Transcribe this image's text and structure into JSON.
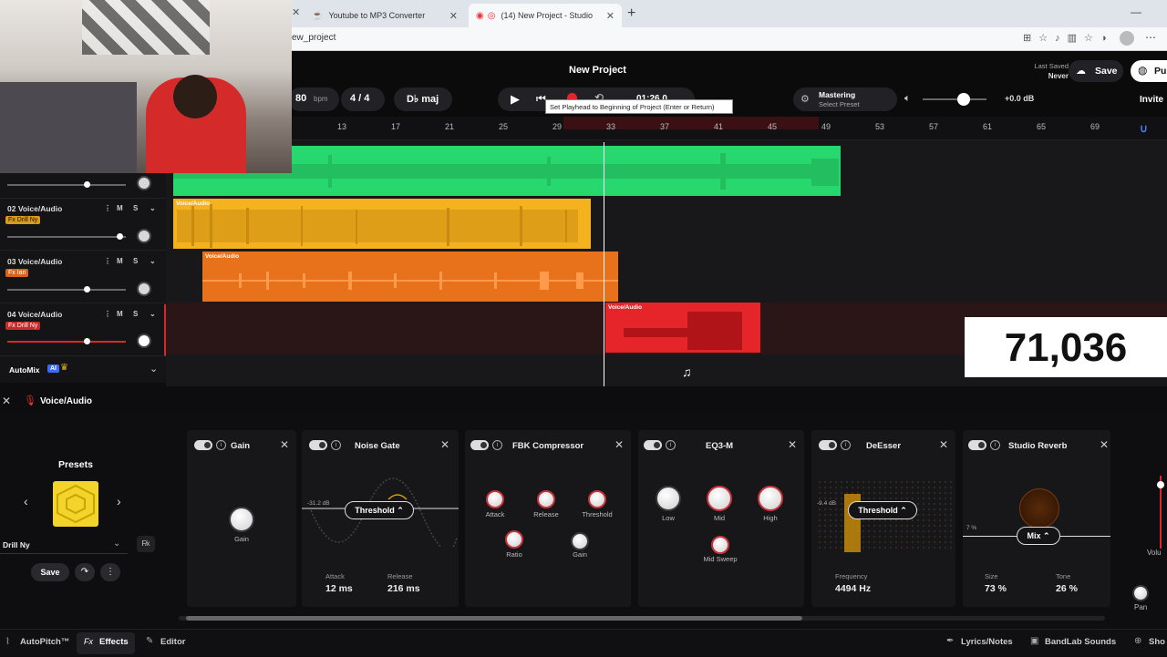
{
  "browser": {
    "tabs": [
      {
        "label": "Youtube to MP3 Converter"
      },
      {
        "label": "(14) New Project - Studio"
      }
    ],
    "url": "ew_project"
  },
  "project": {
    "title": "New Project",
    "last_saved_label": "Last Saved",
    "last_saved_value": "Never",
    "save_label": "Save",
    "publish_label": "Pu",
    "invite_label": "Invite"
  },
  "transport": {
    "bpm": "80",
    "bpm_unit": "bpm",
    "time_signature": "4 / 4",
    "key": "D♭ maj",
    "time_display": "01:26.0",
    "tooltip": "Set Playhead to Beginning of Project (Enter or Return)",
    "mastering_label": "Mastering",
    "mastering_preset": "Select Preset",
    "master_volume_db": "+0.0 dB"
  },
  "ruler": {
    "ticks": [
      "13",
      "17",
      "21",
      "25",
      "29",
      "33",
      "37",
      "41",
      "45",
      "49",
      "53",
      "57",
      "61",
      "65",
      "69"
    ]
  },
  "tracks": [
    {
      "name": "02 Voice/Audio",
      "fx": "Fx Drill Ny",
      "clip_label": "Voice/Audio",
      "color": "#f5b21f"
    },
    {
      "name": "03 Voice/Audio",
      "fx": "Fx Ian",
      "clip_label": "Voice/Audio",
      "color": "#e8721b"
    },
    {
      "name": "04 Voice/Audio",
      "fx": "Fx Drill Ny",
      "clip_label": "Voice/Audio",
      "color": "#e5252a"
    }
  ],
  "track_buttons": {
    "m": "M",
    "s": "S"
  },
  "top_clip_color": "#27d86e",
  "automix": {
    "label": "AutoMix",
    "badge": "AI"
  },
  "overlay_counter": "71,036",
  "fx_panel": {
    "track_label": "Voice/Audio",
    "presets_title": "Presets",
    "preset_name": "Drill Ny",
    "save_label": "Save",
    "effects": [
      {
        "title": "Gain",
        "knobs": [
          "Gain"
        ]
      },
      {
        "title": "Noise Gate",
        "selector": "Threshold",
        "db_readout": "-31.2 dB",
        "params": [
          {
            "label": "Attack",
            "value": "12 ms"
          },
          {
            "label": "Release",
            "value": "216 ms"
          }
        ]
      },
      {
        "title": "FBK Compressor",
        "knobs": [
          "Attack",
          "Release",
          "Threshold",
          "Ratio",
          "Gain"
        ]
      },
      {
        "title": "EQ3-M",
        "knobs": [
          "Low",
          "Mid",
          "High",
          "Mid Sweep"
        ]
      },
      {
        "title": "DeEsser",
        "selector": "Threshold",
        "db_readout": "-9.4 dB",
        "params": [
          {
            "label": "Frequency",
            "value": "4494 Hz"
          }
        ]
      },
      {
        "title": "Studio Reverb",
        "selector": "Mix",
        "mix_readout": "7 %",
        "params": [
          {
            "label": "Size",
            "value": "73 %"
          },
          {
            "label": "Tone",
            "value": "26 %"
          }
        ]
      }
    ],
    "right_labels": {
      "volume": "Volu",
      "pan": "Pan"
    }
  },
  "bottom_bar": {
    "autopitch": "AutoPitch™",
    "effects": "Effects",
    "editor": "Editor",
    "lyrics": "Lyrics/Notes",
    "sounds": "BandLab Sounds",
    "show": "Sho"
  }
}
